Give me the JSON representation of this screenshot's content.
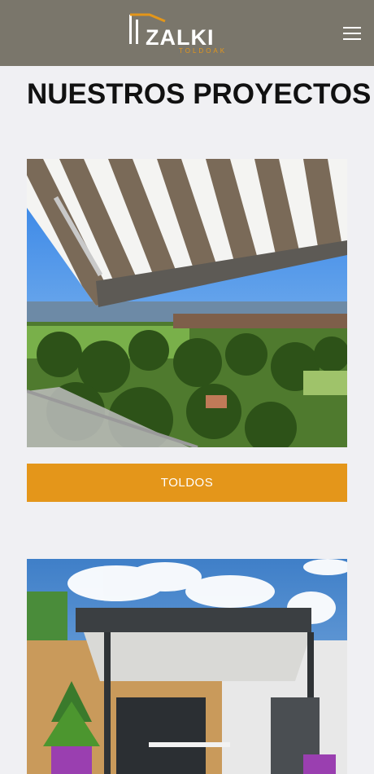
{
  "header": {
    "logo_text": "ZALKI",
    "logo_subtext": "TOLDOAK",
    "menu_icon": "hamburger-menu-icon"
  },
  "colors": {
    "header_bg": "#7a766b",
    "accent": "#e4961a",
    "page_bg": "#f0f0f3"
  },
  "main": {
    "title": "NUESTROS PROYECTOS",
    "projects": [
      {
        "label": "TOLDOS",
        "image": "awning-over-green-valley-photo"
      },
      {
        "label": "",
        "image": "pergola-house-terrace-photo"
      }
    ]
  }
}
